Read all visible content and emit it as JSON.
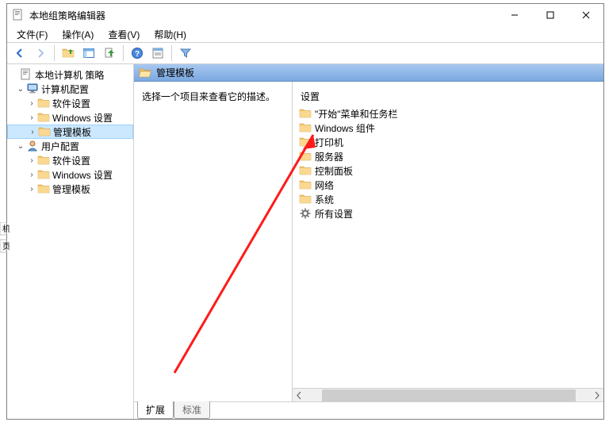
{
  "window": {
    "title": "本地组策略编辑器"
  },
  "menubar": {
    "file": "文件(F)",
    "action": "操作(A)",
    "view": "查看(V)",
    "help": "帮助(H)"
  },
  "tree": {
    "root": "本地计算机 策略",
    "computer": "计算机配置",
    "computer_children": {
      "software": "软件设置",
      "windows": "Windows 设置",
      "templates": "管理模板"
    },
    "user": "用户配置",
    "user_children": {
      "software": "软件设置",
      "windows": "Windows 设置",
      "templates": "管理模板"
    }
  },
  "header": {
    "title": "管理模板"
  },
  "description": {
    "hint": "选择一个项目来查看它的描述。"
  },
  "settings": {
    "header": "设置",
    "items": [
      {
        "label": "\"开始\"菜单和任务栏",
        "icon": "folder"
      },
      {
        "label": "Windows 组件",
        "icon": "folder"
      },
      {
        "label": "打印机",
        "icon": "folder"
      },
      {
        "label": "服务器",
        "icon": "folder"
      },
      {
        "label": "控制面板",
        "icon": "folder"
      },
      {
        "label": "网络",
        "icon": "folder"
      },
      {
        "label": "系统",
        "icon": "folder"
      },
      {
        "label": "所有设置",
        "icon": "gear"
      }
    ]
  },
  "tabs": {
    "extended": "扩展",
    "standard": "标准"
  }
}
